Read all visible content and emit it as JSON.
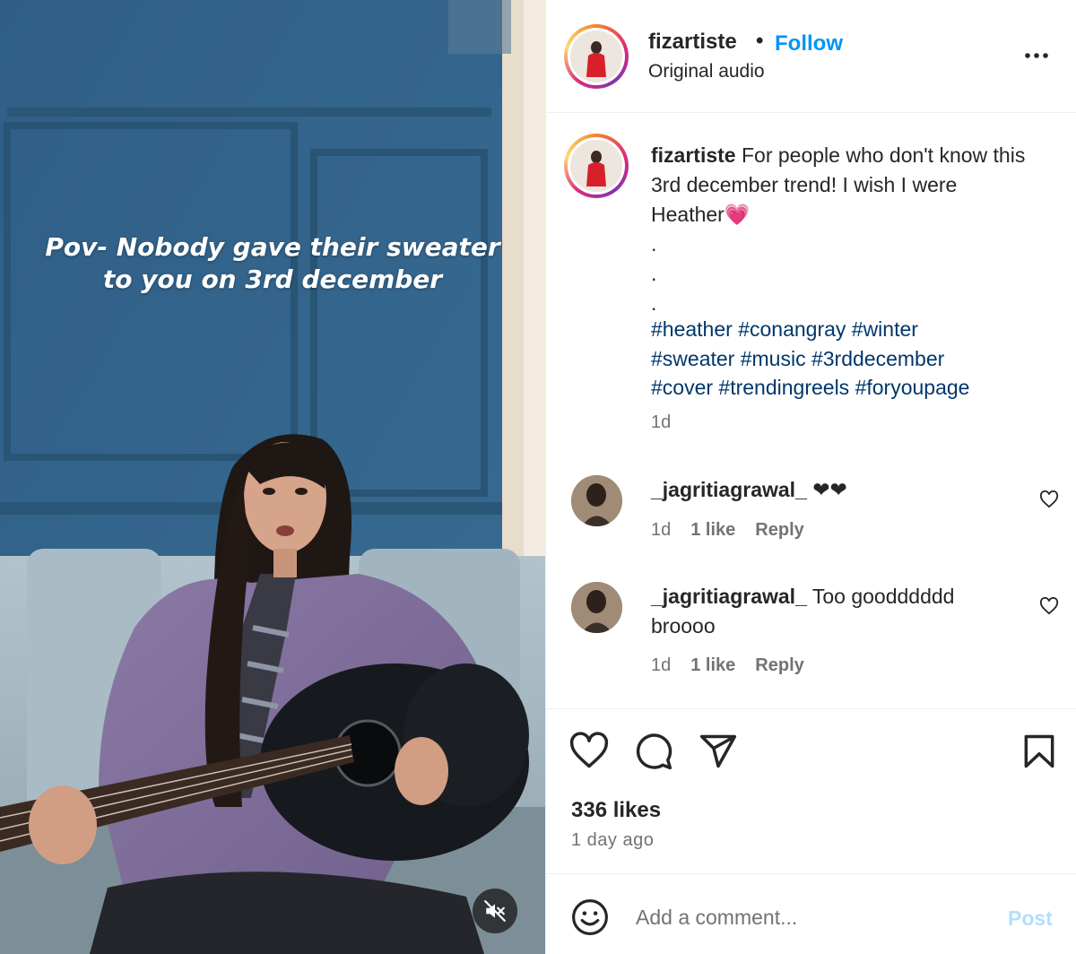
{
  "video": {
    "overlay_caption_line1": "Pov- Nobody gave their sweater",
    "overlay_caption_line2": "to you on 3rd december",
    "mute_icon": "speaker-muted-icon"
  },
  "header": {
    "username": "fizartiste",
    "separator": "•",
    "follow_label": "Follow",
    "audio_label": "Original audio",
    "more_icon": "more-options-icon"
  },
  "caption": {
    "username": "fizartiste",
    "text": "For people who don't know this 3rd december trend! I wish I were Heather💗",
    "dots": [
      ".",
      ".",
      "."
    ],
    "hashtags_line1": "#heather #conangray #winter",
    "hashtags_line2": "#sweater #music #3rddecember",
    "hashtags_line3": "#cover #trendingreels #foryoupage",
    "time": "1d"
  },
  "comments": [
    {
      "username": "_jagritiagrawal_",
      "text": "❤❤",
      "time": "1d",
      "likes": "1 like",
      "reply_label": "Reply"
    },
    {
      "username": "_jagritiagrawal_",
      "text": "Too goodddddd broooo",
      "time": "1d",
      "likes": "1 like",
      "reply_label": "Reply"
    }
  ],
  "actions": {
    "like_icon": "heart-icon",
    "comment_icon": "comment-bubble-icon",
    "share_icon": "paper-plane-icon",
    "save_icon": "bookmark-icon",
    "likes_count": "336 likes",
    "post_time": "1 day ago"
  },
  "comment_bar": {
    "emoji_icon": "emoji-smiley-icon",
    "placeholder": "Add a comment...",
    "post_label": "Post"
  },
  "colors": {
    "accent": "#0095f6",
    "hashtag": "#00376b",
    "muted_text": "#737373",
    "post_disabled": "#b2dffc"
  }
}
